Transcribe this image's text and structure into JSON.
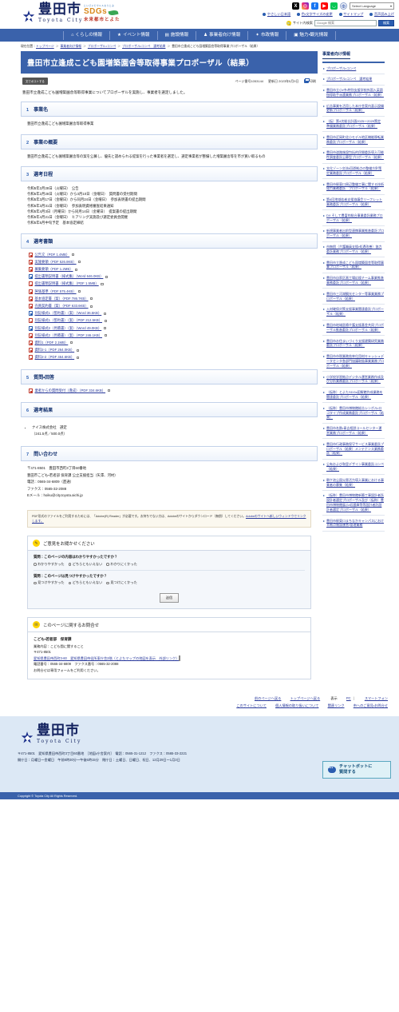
{
  "header": {
    "logo_jp": "豊田市",
    "logo_en": "Toyota City",
    "sdgs_top": "といざいだウルルおりとみ",
    "sdgs_main": "SDGs",
    "sdgs_sub": "未来都市とよた",
    "social": [
      {
        "name": "x-icon",
        "glyph": "X"
      },
      {
        "name": "instagram-icon",
        "glyph": "◉"
      },
      {
        "name": "facebook-icon",
        "glyph": "f"
      },
      {
        "name": "youtube-icon",
        "glyph": "▶"
      },
      {
        "name": "line-icon",
        "glyph": "💬"
      },
      {
        "name": "globe-icon",
        "glyph": "⊕"
      }
    ],
    "language_select": "Select Language",
    "util_links": [
      "やさしい日本語",
      "色・文字サイズの変更",
      "サイトマップ",
      "音声読み上げ"
    ],
    "search_label": "サイト内検索",
    "search_placeholder": "Google 検索",
    "search_button": "検索"
  },
  "gnav": [
    {
      "label": "くらしの情報",
      "icon": "home-icon",
      "glyph": "⌂"
    },
    {
      "label": "イベント情報",
      "icon": "star-icon",
      "glyph": "★"
    },
    {
      "label": "施設情報",
      "icon": "building-icon",
      "glyph": "▤"
    },
    {
      "label": "事業者向け情報",
      "icon": "briefcase-icon",
      "glyph": "♟"
    },
    {
      "label": "市政情報",
      "icon": "city-icon",
      "glyph": "✦"
    },
    {
      "label": "魅力・観光情報",
      "icon": "camera-icon",
      "glyph": "▣"
    }
  ],
  "breadcrumb": {
    "prefix": "現在位置：",
    "items": [
      "トップページ",
      "事業者向け情報",
      "プロポーザル・コンペ",
      "プロポーザル・コンペ　選考結果"
    ],
    "current": "豊田市立逢成こども園増築園舎等取得事業プロポーザル（結果）"
  },
  "page": {
    "title": "豊田市立逢成こども園増築園舎等取得事業プロポーザル（結果）",
    "post_button": "文でポストする",
    "page_number": "ページ番号1053144",
    "updated": "更新日 2023年5月9日",
    "print": "印刷",
    "lead": "豊田市立逢成こども園増築園舎等取得事業についてプロポーザルを実施し、事業者を選定しました。"
  },
  "sections": [
    {
      "num": "1",
      "title": "事業名",
      "body": [
        "豊田市立逢成こども園増築園舎等取得事業"
      ]
    },
    {
      "num": "2",
      "title": "事業の概要",
      "body": [
        "豊田市立逢成こども園増築園舎等の案を公募し、優先と認められる提案を行った事業者を選定し、選定事業者が整備した増築園舎等を市が買い取るもの"
      ]
    },
    {
      "num": "3",
      "title": "選考日程",
      "body": [
        "令和5年2月28日（火曜日）　公告",
        "令和5年2月28日（火曜日）から3月10日（金曜日）　質問書の受付期間",
        "令和5年3月17日（金曜日）から同月24日（金曜日）　参加表明書の提出期間",
        "令和5年3月31日（金曜日）　参加表明資格審査結果通知",
        "令和5年4月3日（月曜日）から同月14日（金曜日）　提案書の提出期間",
        "令和5年4月21日（金曜日）　ヒアリング実施及び選定委員会開催",
        "令和5年6月中旬予定　基本協定締結"
      ]
    }
  ],
  "documents": {
    "num": "4",
    "title": "選考書類",
    "files": [
      {
        "label": "公告文（PDF 1.4MB）",
        "type": "pdf"
      },
      {
        "label": "実施要領（PDF 526.8KB）",
        "type": "pdf"
      },
      {
        "label": "募集要領（PDF 1.2MB）",
        "type": "pdf"
      },
      {
        "label": "提出書類説明書（様式集）（Word 646.0KB）",
        "type": "word"
      },
      {
        "label": "提出書類説明書（様式集）（PDF 1.5MB）",
        "type": "pdf"
      },
      {
        "label": "評価基準（PDF 575.4KB）",
        "type": "pdf"
      },
      {
        "label": "基本協定書（案）（PDF 786.7KB）",
        "type": "pdf"
      },
      {
        "label": "売買契約書（案）（PDF 633.6KB）",
        "type": "pdf"
      },
      {
        "label": "別記様式1（誓約書）（案）（Word 36.5KB）",
        "type": "word"
      },
      {
        "label": "別記様式1（誓約書）（案）（PDF 212.5KB）",
        "type": "pdf"
      },
      {
        "label": "別記様式2（見積書）（案）（Word 49.0KB）",
        "type": "word"
      },
      {
        "label": "別記様式2（見積書）（案）（PDF 246.1KB）",
        "type": "pdf"
      },
      {
        "label": "資料1（PDF 2.1MB）",
        "type": "pdf"
      },
      {
        "label": "資料2-1（PDF 264.0KB）",
        "type": "pdf"
      },
      {
        "label": "資料2-2（PDF 464.6KB）",
        "type": "pdf"
      }
    ]
  },
  "qa": {
    "num": "5",
    "title": "質問・回答",
    "files": [
      {
        "label": "業者からの質問受付（逢成）（PDF 334.6KB）",
        "type": "pdf"
      }
    ]
  },
  "result": {
    "num": "6",
    "title": "選考結果",
    "items": [
      "ナイス株式会社　選定",
      "（241.5点／500.0点）"
    ]
  },
  "contact_section": {
    "num": "7",
    "title": "問い合わせ",
    "lines": [
      "〒471-8501　豊田市西町3丁目60番地",
      "豊田市こども・若者部 保育課 公立支援担当（矢澤、河村）",
      "電話：0565-34-6809（直通）",
      "ファクス：0565-32-2088",
      "Eメール：hoiku@city.toyota.aichi.jp"
    ]
  },
  "pdf_note": {
    "text": "PDF形式のファイルをご利用するためには、「Adobe(R) Reader」が必要です。お持ちでない方は、Adobeのサイトからダウンロード（無償）してください。",
    "link": "Adobeのサイトへ新しいウィンドウでリンクします。"
  },
  "feedback": {
    "title": "ご意見をお聞かせください",
    "icon": "pencil-icon",
    "q1": "質問：このページの内容はわかりやすかったですか？",
    "q1_options": [
      "わかりやすかった",
      "どちらともいえない",
      "わかりにくかった"
    ],
    "q2": "質問：このページは見つけやすかったですか？",
    "q2_options": [
      "見つけやすかった",
      "どちらともいえない",
      "見つけにくかった"
    ],
    "submit": "送信"
  },
  "inquiry": {
    "title": "このページに関するお問合せ",
    "icon": "mail-icon",
    "dept": "こども・若者部　保育課",
    "lines": [
      "業務内容：こども園に関すること",
      "〒471-8501"
    ],
    "address_link": "愛知県豊田市西町3-60　愛知県豊田市役所東庁舎2階（とよたマップの地図を表示　外部リンク）",
    "tel_line": "電話番号：0565-34-6809　ファクス番号：0565-32-2088",
    "form_line": "お問合せは専用フォームをご利用ください。"
  },
  "sidebar": {
    "heading": "事業者向け情報",
    "items": [
      "プロポーザル・コンペ",
      "プロポーザル・コンペ　選考結果",
      "豊田市立小・中・特別支援学校外国人英語指導助手派遣業務プロポーザル（結果）",
      "広告事業を活用した本庁舎案内表示設備更新プロポーザル（結果）",
      "（仮）第4次総合計画2025～2029策定準備業務委託プロポーザル（結果）",
      "豊田市近岡町北小モデル地区機能移転業務委託プロポーザル（結果）",
      "豊田市道路施設包括的民間委託導入可能性調査委託公募型プロポーザル（結果）",
      "文化ゾーン交流・回遊拠点の整備方針策定業務委託プロポーザル（結果）",
      "豊田市駅東口周辺整備工事に関する技術協力業務委託　プロポーザル（結果）",
      "第6回地域若者支援協議会リーフレット業務委託プロポーザル（結果）",
      "DX そして豊富的総合事業委託業務プロポーザル（結果）",
      "新規事業者出前型連携事業推進委託プロポーザル（結果）",
      "市無償（介護職員支援・処遇改善）協力委託業務プロポーザル（結果）",
      "豊田市立逢成こども園増築園舎等取得事業プロポーザル（結果）",
      "豊田市自家区画工場応援チーム事業推進業務委託プロポーザル（結果）",
      "豊田市三河湖観光センター等事業業務プロポーザル（結果）",
      "人材確保対策支援事業関連委託プロポーザル（結果）",
      "豊田市地域医療介護支援基金共同プロポーザル推進委託プロポーザル（結果）",
      "豊田市お住まいづくり支援建築研究業務委託プロポーザル（結果）",
      "豊田市市税業務効率化用材キャッシュデータセンタ各部門協議取扱事業業務プロポーザル（結果）",
      "小学校学習拠点デジタル運営業務作成及び分析業務委託プロポーザル（結果）",
      "（仮称）とよたSDGs図解館作成業務を関連委託プロポーザル（結果）",
      "（仮称）豊田市博物館総合シンボル・ロゴタイプ作成業務委託プロポーザル（結果）",
      "豊田市名鉄・青吉相談コールセンター運営業務プロポーザル（結果）",
      "豊田市行政事務保守サービス事業委託プロポーザル（結果）メンテナンス業務委託（結果）",
      "公有および和里デザイン事業委託コンペ（結果）",
      "朝ケ池公園災害活力導入事業における事業者の募集（結果）",
      "（仮称）豊田市博物館新築工事設計者託設計者選定プロポーザル及び（仮称）豊田市博物館展示・収蔵庫等等設計者託設計者選定プロポーザル（結果）",
      "豊田市駅東口まちなかキャンパスにおける拠点施設運営・管理業務"
    ]
  },
  "footer_links": {
    "row1": [
      "前のページへ戻る",
      "トップページへ戻る"
    ],
    "display_label": "表示",
    "display_options": [
      "PC",
      "スマートフォン"
    ],
    "row2": [
      "このサイトについて",
      "個人情報の取り扱いについて",
      "関連リンク",
      "市へのご意見・お問合せ"
    ]
  },
  "footer": {
    "logo_jp": "豊田市",
    "logo_en": "Toyota City",
    "addr_line1": "〒471-8501　愛知県豊田市西町3丁目60番地　［地図・庁舎案内］　電話：0565-31-1212　ファクス：0565-33-2221",
    "addr_line2": "開庁日：月曜日～金曜日　午前8時30分～午後5時15分　閉庁日：土曜日、日曜日、祝日、12月29日～1月3日",
    "map_link": "地図・庁舎案内",
    "copyright": "Copyright © Toyota City All Rights Reserved.",
    "chatbot": "チャットボットに質問する",
    "chatbot_line1": "チャットボットに",
    "chatbot_line2": "質問する"
  }
}
